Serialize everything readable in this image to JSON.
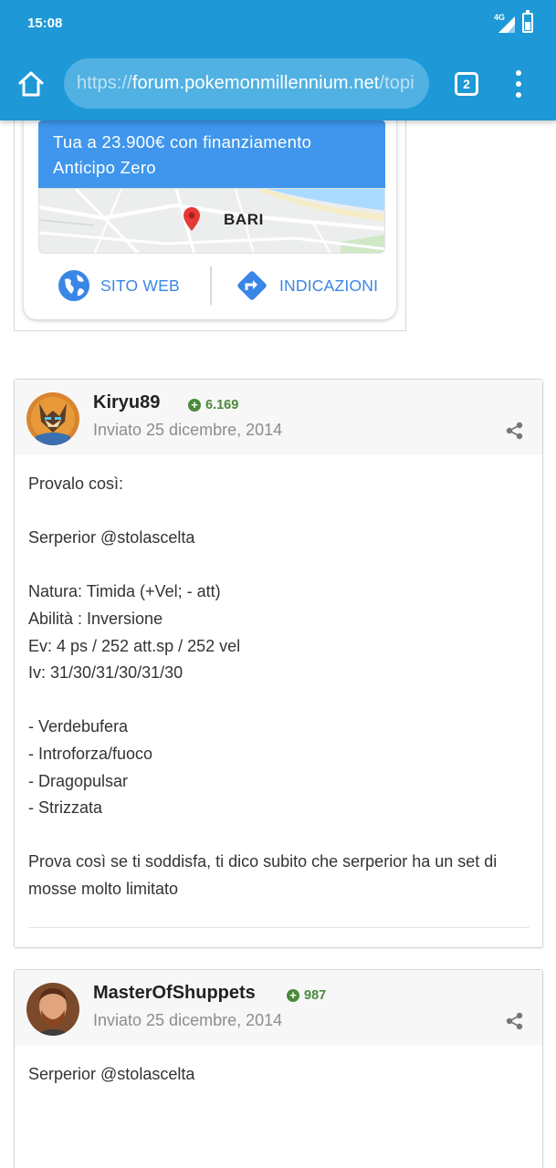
{
  "status_bar": {
    "time": "15:08",
    "network": "4G"
  },
  "browser": {
    "url_scheme": "https://",
    "url_host": "forum.pokemonmillennium.net",
    "url_path": "/topi",
    "tab_count": "2"
  },
  "ad": {
    "banner_text": "Tua a 23.900€ con finanziamento Anticipo Zero",
    "map_label": "BARI",
    "website_label": "SITO WEB",
    "directions_label": "INDICAZIONI",
    "accent_color": "#3f96ec"
  },
  "posts": [
    {
      "author": "Kiryu89",
      "reputation": "6.169",
      "date": "Inviato 25 dicembre, 2014",
      "lines": [
        "Provalo così:",
        "",
        "Serperior @stolascelta",
        "",
        "Natura: Timida (+Vel; - att)",
        "Abilità : Inversione",
        "Ev: 4 ps / 252 att.sp / 252 vel",
        "Iv: 31/30/31/30/31/30",
        "",
        "- Verdebufera",
        "- Introforza/fuoco",
        "- Dragopulsar",
        "- Strizzata",
        "",
        "Prova così se ti soddisfa, ti dico subito che serperior ha un set di",
        "mosse molto limitato"
      ]
    },
    {
      "author": "MasterOfShuppets",
      "reputation": "987",
      "date": "Inviato 25 dicembre, 2014",
      "lines": [
        "Serperior @stolascelta"
      ]
    }
  ]
}
